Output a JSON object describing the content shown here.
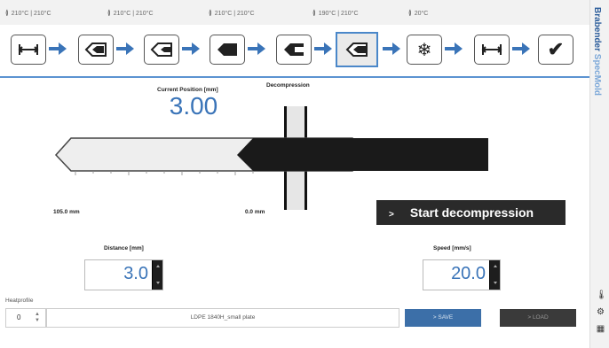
{
  "temps": [
    {
      "icon": "heater-icon",
      "text": "210°C | 210°C"
    },
    {
      "icon": "heater-icon",
      "text": "210°C | 210°C"
    },
    {
      "icon": "heater-icon",
      "text": "210°C | 210°C"
    },
    {
      "icon": "heater-icon",
      "text": "190°C | 210°C"
    },
    {
      "icon": "heater-icon",
      "text": "20°C"
    }
  ],
  "steps": [
    {
      "name": "step-distance-icon",
      "active": false
    },
    {
      "name": "step-injection-icon",
      "active": false
    },
    {
      "name": "step-holding-icon",
      "active": false
    },
    {
      "name": "step-plasticizing-icon",
      "active": false
    },
    {
      "name": "step-screw-icon",
      "active": false
    },
    {
      "name": "step-decompression-icon",
      "active": true
    },
    {
      "name": "step-cooling-icon",
      "active": false
    },
    {
      "name": "step-open-icon",
      "active": false
    },
    {
      "name": "step-done-icon",
      "active": false
    }
  ],
  "brand": {
    "name": "Brabender",
    "product": "SpecMold"
  },
  "main": {
    "section_title": "Decompression",
    "readout_label": "Current Position [mm]",
    "readout_value": "3.00",
    "scale_left": "105.0 mm",
    "scale_right": "0.0 mm",
    "start_button": "Start decompression",
    "start_arrow": ">"
  },
  "distance": {
    "label": "Distance [mm]",
    "value": "3.0"
  },
  "speed": {
    "label": "Speed [mm/s]",
    "value": "20.0"
  },
  "profile": {
    "label": "Heatprofile",
    "number": "0",
    "name": "LDPE 1840H_small plate",
    "save": "> SAVE",
    "load": "> LOAD"
  },
  "colors": {
    "accent": "#3a74b8",
    "dark": "#1e1e1e",
    "active_step": "#4a87c9"
  }
}
